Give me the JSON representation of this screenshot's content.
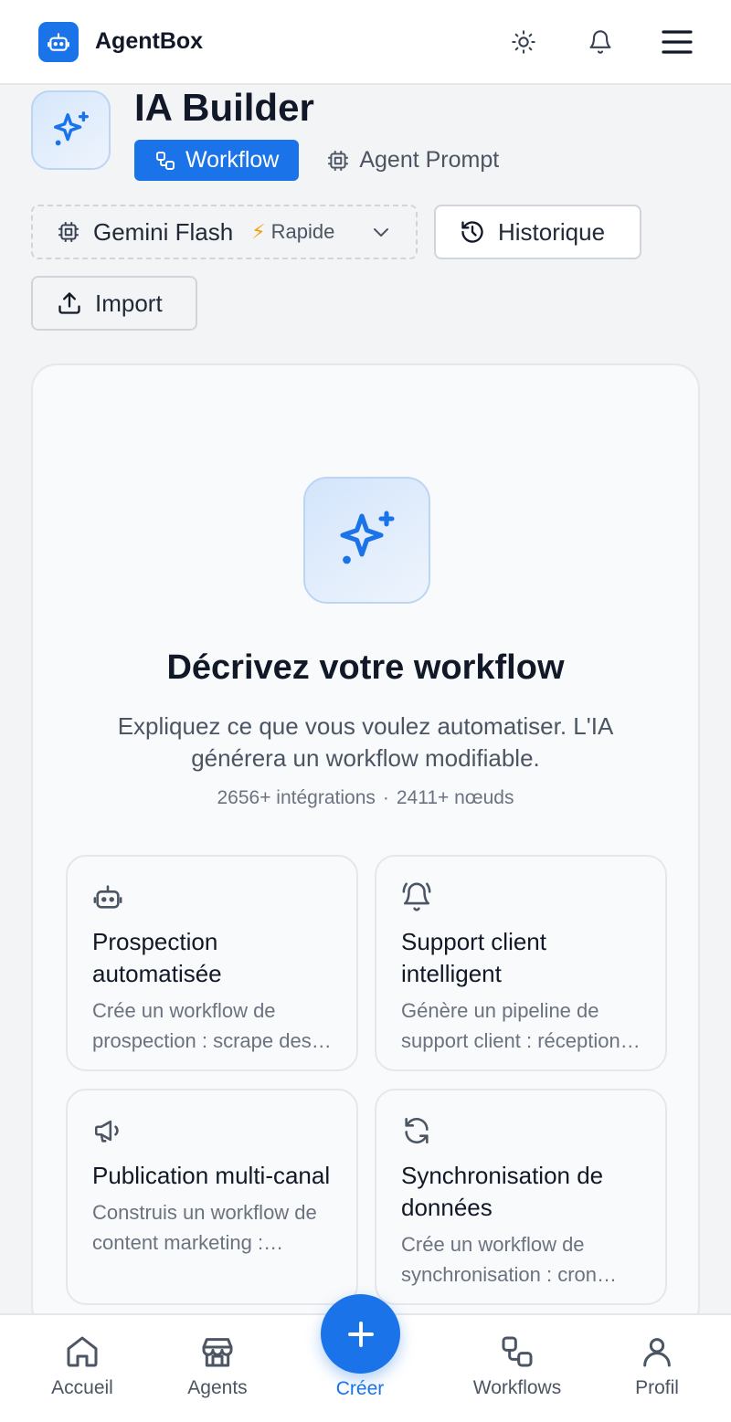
{
  "app": {
    "name": "AgentBox"
  },
  "header": {
    "title": "IA Builder",
    "tabs": [
      {
        "label": "Workflow",
        "active": true
      },
      {
        "label": "Agent Prompt",
        "active": false
      }
    ]
  },
  "controls": {
    "model": {
      "name": "Gemini Flash",
      "speed_label": "Rapide",
      "speed_icon": "⚡"
    },
    "history_label": "Historique",
    "import_label": "Import"
  },
  "empty_state": {
    "title": "Décrivez votre workflow",
    "description": "Expliquez ce que vous voulez automatiser. L'IA générera un workflow modifiable.",
    "stats": {
      "integrations": "2656+ intégrations",
      "separator": "·",
      "nodes": "2411+ nœuds"
    }
  },
  "suggestions": [
    {
      "icon": "robot-icon",
      "title": "Prospection automatisée",
      "description": "Crée un workflow de prospection : scrape des leads"
    },
    {
      "icon": "bell-ring-icon",
      "title": "Support client intelligent",
      "description": "Génère un pipeline de support client : réception des tickets"
    },
    {
      "icon": "megaphone-icon",
      "title": "Publication multi-canal",
      "description": "Construis un workflow de content marketing : rédaction"
    },
    {
      "icon": "sync-icon",
      "title": "Synchronisation de données",
      "description": "Crée un workflow de synchronisation : cron quotidien"
    }
  ],
  "bottom_nav": [
    {
      "label": "Accueil",
      "icon": "home-icon"
    },
    {
      "label": "Agents",
      "icon": "store-icon"
    },
    {
      "label": "Créer",
      "icon": "plus-icon",
      "active": true
    },
    {
      "label": "Workflows",
      "icon": "workflow-icon"
    },
    {
      "label": "Profil",
      "icon": "user-icon"
    }
  ],
  "colors": {
    "primary": "#1a73e8",
    "background": "#f3f4f6",
    "text": "#111827",
    "muted": "#6b7280"
  }
}
